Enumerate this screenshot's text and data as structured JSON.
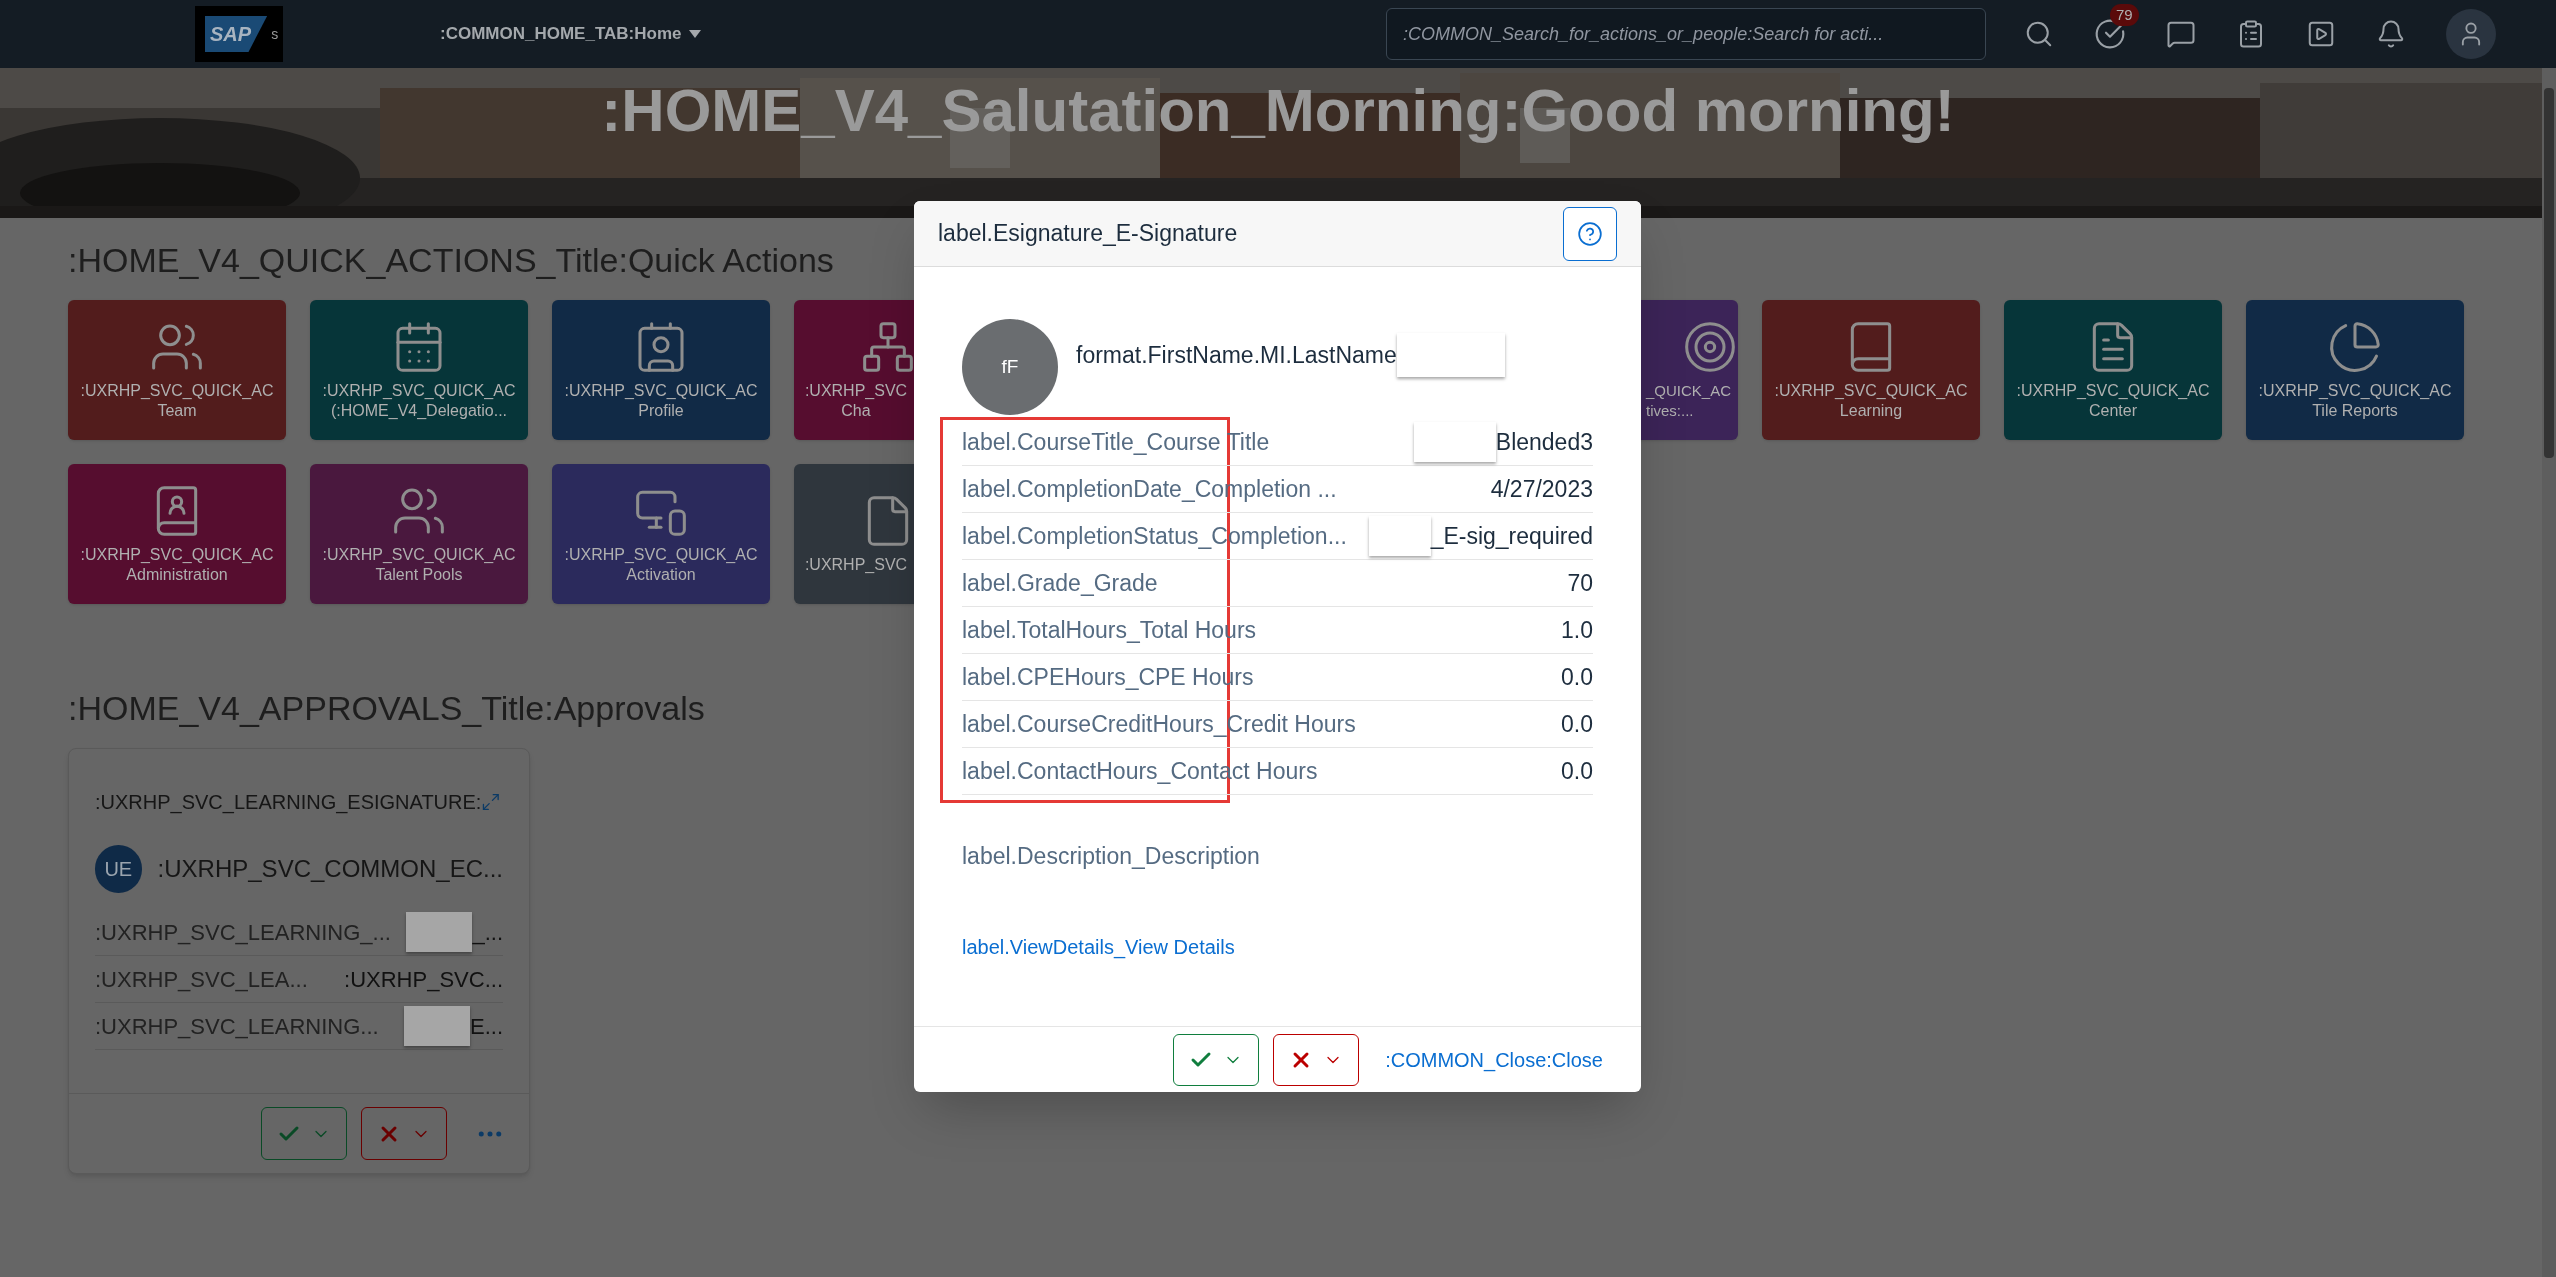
{
  "header": {
    "logo": "SAP",
    "logo_suffix": "s",
    "home_menu": ":COMMON_HOME_TAB:Home",
    "search": {
      "placeholder": ":COMMON_Search_for_actions_or_people:Search for acti..."
    },
    "todo_badge": "79"
  },
  "hero": {
    "greeting": ":HOME_V4_Salutation_Morning:Good morning!"
  },
  "quick_actions": {
    "title": ":HOME_V4_QUICK_ACTIONS_Title:Quick Actions",
    "rows": [
      [
        {
          "kind": "full",
          "color": "#521c1c",
          "lines": [
            ":UXRHP_SVC_QUICK_AC",
            "Team"
          ]
        },
        {
          "kind": "full",
          "color": "#063539",
          "lines": [
            ":UXRHP_SVC_QUICK_AC",
            "(:HOME_V4_Delegatio..."
          ]
        },
        {
          "kind": "full",
          "color": "#112a46",
          "lines": [
            ":UXRHP_SVC_QUICK_AC",
            "Profile"
          ]
        },
        {
          "kind": "cut_right",
          "color": "#560d2f",
          "lines": [
            ":UXRHP_SVC",
            "Cha"
          ]
        },
        {
          "kind": "hidden"
        },
        {
          "kind": "hidden"
        },
        {
          "kind": "cut_left",
          "color": "#3c2458",
          "lines": [
            "_QUICK_AC",
            "tives:..."
          ]
        },
        {
          "kind": "full",
          "color": "#521c1c",
          "lines": [
            ":UXRHP_SVC_QUICK_AC",
            "Learning"
          ]
        },
        {
          "kind": "full",
          "color": "#063539",
          "lines": [
            ":UXRHP_SVC_QUICK_AC",
            "Center"
          ]
        },
        {
          "kind": "full",
          "color": "#112a46",
          "lines": [
            ":UXRHP_SVC_QUICK_AC",
            "Tile Reports"
          ]
        }
      ],
      [
        {
          "kind": "full",
          "color": "#560d2f",
          "lines": [
            ":UXRHP_SVC_QUICK_AC",
            "Administration"
          ]
        },
        {
          "kind": "full",
          "color": "#4a183e",
          "lines": [
            ":UXRHP_SVC_QUICK_AC",
            "Talent Pools"
          ]
        },
        {
          "kind": "full",
          "color": "#2b2a5c",
          "lines": [
            ":UXRHP_SVC_QUICK_AC",
            "Activation"
          ]
        },
        {
          "kind": "cut_right",
          "color": "#2f363d",
          "lines": [
            ":UXRHP_SVC"
          ]
        }
      ]
    ]
  },
  "approvals": {
    "title": ":HOME_V4_APPROVALS_Title:Approvals",
    "card": {
      "title": ":UXRHP_SVC_LEARNING_ESIGNATURE:",
      "avatar": "UE",
      "person": ":UXRHP_SVC_COMMON_EC...",
      "rows": [
        {
          "label": ":UXRHP_SVC_LEARNING_...",
          "value": "_...",
          "redacted": true
        },
        {
          "label": ":UXRHP_SVC_LEA...",
          "value": ":UXRHP_SVC...",
          "redacted": false
        },
        {
          "label": ":UXRHP_SVC_LEARNING...",
          "value": "E...",
          "redacted": true
        }
      ]
    }
  },
  "dialog": {
    "title": "label.Esignature_E-Signature",
    "avatar": "fF",
    "name": "format.FirstName.MI.LastName",
    "name_redacted": true,
    "rows": [
      {
        "label": "label.CourseTitle_Course Title",
        "value": "Blended3",
        "redacted": true
      },
      {
        "label": "label.CompletionDate_Completion ...",
        "value": "4/27/2023",
        "redacted": false
      },
      {
        "label": "label.CompletionStatus_Completion...",
        "value": "_E-sig_required",
        "redacted": true
      },
      {
        "label": "label.Grade_Grade",
        "value": "70",
        "redacted": false
      },
      {
        "label": "label.TotalHours_Total Hours",
        "value": "1.0",
        "redacted": false
      },
      {
        "label": "label.CPEHours_CPE Hours",
        "value": "0.0",
        "redacted": false
      },
      {
        "label": "label.CourseCreditHours_Credit Hours",
        "value": "0.0",
        "redacted": false
      },
      {
        "label": "label.ContactHours_Contact Hours",
        "value": "0.0",
        "redacted": false
      }
    ],
    "description": "label.Description_Description",
    "link": "label.ViewDetails_View Details",
    "close": ":COMMON_Close:Close"
  }
}
